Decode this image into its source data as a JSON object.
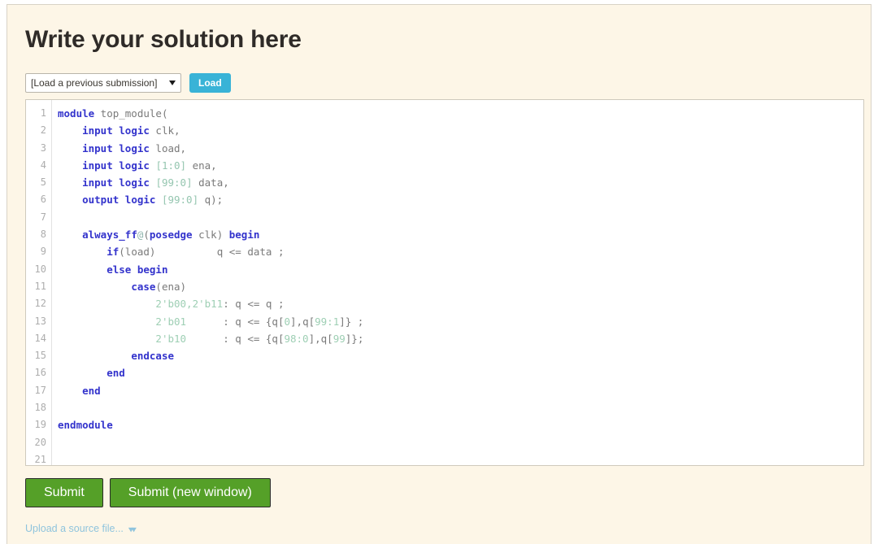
{
  "page": {
    "title": "Write your solution here",
    "background_color": "#fdf6e7",
    "border_color": "#d8d3c7"
  },
  "load_row": {
    "select": {
      "selected_label": "[Load a previous submission]",
      "caret_icon": "chevron-down-icon"
    },
    "load_button": {
      "label": "Load",
      "color": "#39b3d7"
    }
  },
  "editor": {
    "line_numbers": [
      "1",
      "2",
      "3",
      "4",
      "5",
      "6",
      "7",
      "8",
      "9",
      "10",
      "11",
      "12",
      "13",
      "14",
      "15",
      "16",
      "17",
      "18",
      "19",
      "20",
      "21"
    ],
    "lines": [
      {
        "n": "1",
        "tokens": [
          {
            "t": "module",
            "c": "kw"
          },
          {
            "t": " top_module(",
            "c": "plain"
          }
        ]
      },
      {
        "n": "2",
        "tokens": [
          {
            "t": "    ",
            "c": "plain"
          },
          {
            "t": "input logic",
            "c": "kw"
          },
          {
            "t": " clk,",
            "c": "plain"
          }
        ]
      },
      {
        "n": "3",
        "tokens": [
          {
            "t": "    ",
            "c": "plain"
          },
          {
            "t": "input logic",
            "c": "kw"
          },
          {
            "t": " load,",
            "c": "plain"
          }
        ]
      },
      {
        "n": "4",
        "tokens": [
          {
            "t": "    ",
            "c": "plain"
          },
          {
            "t": "input logic",
            "c": "kw"
          },
          {
            "t": " ",
            "c": "plain"
          },
          {
            "t": "[1:0]",
            "c": "num"
          },
          {
            "t": " ena,",
            "c": "plain"
          }
        ]
      },
      {
        "n": "5",
        "tokens": [
          {
            "t": "    ",
            "c": "plain"
          },
          {
            "t": "input logic",
            "c": "kw"
          },
          {
            "t": " ",
            "c": "plain"
          },
          {
            "t": "[99:0]",
            "c": "num"
          },
          {
            "t": " data,",
            "c": "plain"
          }
        ]
      },
      {
        "n": "6",
        "tokens": [
          {
            "t": "    ",
            "c": "plain"
          },
          {
            "t": "output logic",
            "c": "kw"
          },
          {
            "t": " ",
            "c": "plain"
          },
          {
            "t": "[99:0]",
            "c": "num"
          },
          {
            "t": " q);",
            "c": "plain"
          }
        ]
      },
      {
        "n": "7",
        "tokens": []
      },
      {
        "n": "8",
        "tokens": [
          {
            "t": "    ",
            "c": "plain"
          },
          {
            "t": "always_ff",
            "c": "kw"
          },
          {
            "t": "@",
            "c": "at"
          },
          {
            "t": "(",
            "c": "plain"
          },
          {
            "t": "posedge",
            "c": "kw"
          },
          {
            "t": " clk) ",
            "c": "plain"
          },
          {
            "t": "begin",
            "c": "kw"
          }
        ]
      },
      {
        "n": "9",
        "tokens": [
          {
            "t": "        ",
            "c": "plain"
          },
          {
            "t": "if",
            "c": "kw"
          },
          {
            "t": "(load)          q <= data ;",
            "c": "plain"
          }
        ]
      },
      {
        "n": "10",
        "tokens": [
          {
            "t": "        ",
            "c": "plain"
          },
          {
            "t": "else begin",
            "c": "kw"
          }
        ]
      },
      {
        "n": "11",
        "tokens": [
          {
            "t": "            ",
            "c": "plain"
          },
          {
            "t": "case",
            "c": "kw"
          },
          {
            "t": "(ena)",
            "c": "plain"
          }
        ]
      },
      {
        "n": "12",
        "tokens": [
          {
            "t": "                ",
            "c": "plain"
          },
          {
            "t": "2'b00,2'b11",
            "c": "lit"
          },
          {
            "t": ": q <= q ;",
            "c": "plain"
          }
        ]
      },
      {
        "n": "13",
        "tokens": [
          {
            "t": "                ",
            "c": "plain"
          },
          {
            "t": "2'b01",
            "c": "lit"
          },
          {
            "t": "      : q <= {q[",
            "c": "plain"
          },
          {
            "t": "0",
            "c": "lit"
          },
          {
            "t": "],q[",
            "c": "plain"
          },
          {
            "t": "99:1",
            "c": "lit"
          },
          {
            "t": "]} ;",
            "c": "plain"
          }
        ]
      },
      {
        "n": "14",
        "tokens": [
          {
            "t": "                ",
            "c": "plain"
          },
          {
            "t": "2'b10",
            "c": "lit"
          },
          {
            "t": "      : q <= {q[",
            "c": "plain"
          },
          {
            "t": "98:0",
            "c": "lit"
          },
          {
            "t": "],q[",
            "c": "plain"
          },
          {
            "t": "99",
            "c": "lit"
          },
          {
            "t": "]};",
            "c": "plain"
          }
        ]
      },
      {
        "n": "15",
        "tokens": [
          {
            "t": "            ",
            "c": "plain"
          },
          {
            "t": "endcase",
            "c": "kw"
          }
        ]
      },
      {
        "n": "16",
        "tokens": [
          {
            "t": "        ",
            "c": "plain"
          },
          {
            "t": "end",
            "c": "kw"
          }
        ]
      },
      {
        "n": "17",
        "tokens": [
          {
            "t": "    ",
            "c": "plain"
          },
          {
            "t": "end",
            "c": "kw"
          }
        ]
      },
      {
        "n": "18",
        "tokens": []
      },
      {
        "n": "19",
        "tokens": [
          {
            "t": "endmodule",
            "c": "kw"
          }
        ]
      },
      {
        "n": "20",
        "tokens": []
      },
      {
        "n": "21",
        "tokens": []
      }
    ]
  },
  "actions": {
    "submit_label": "Submit",
    "submit_new_window_label": "Submit (new window)",
    "button_color": "#55a028"
  },
  "upload": {
    "label": "Upload a source file...",
    "expand_icon": "double-chevron-down-icon",
    "link_color": "#8fc4dd"
  }
}
